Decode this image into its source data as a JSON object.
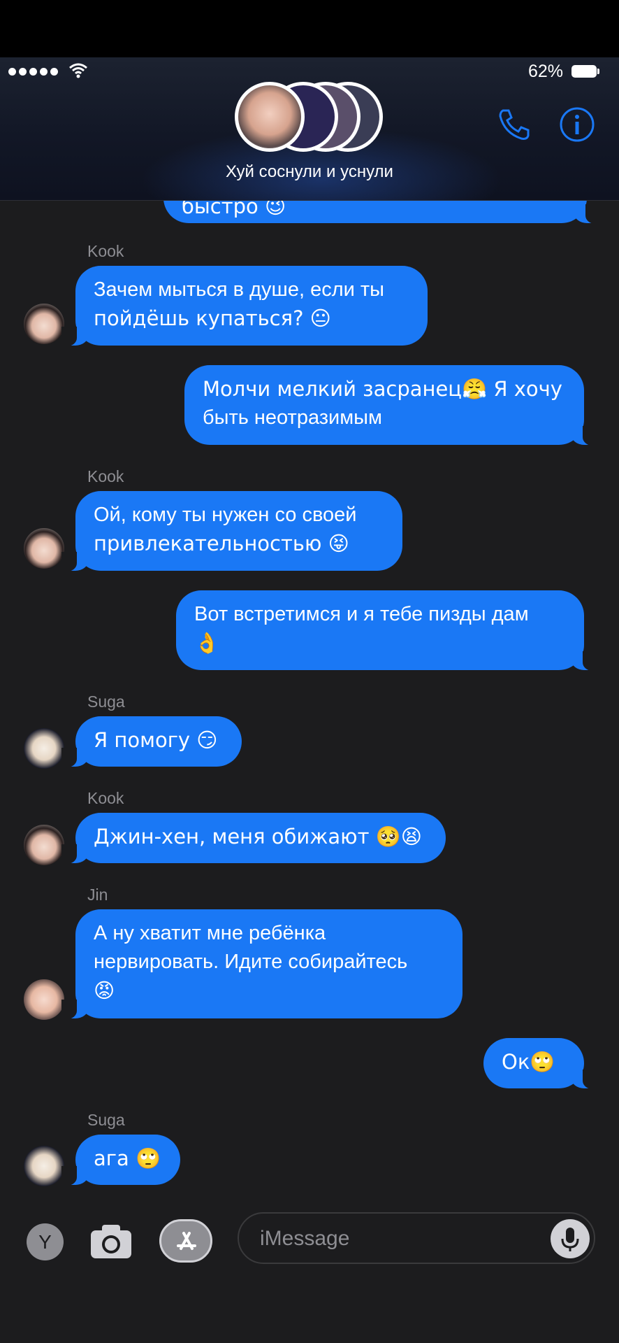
{
  "status": {
    "battery": "62%"
  },
  "header": {
    "group_name": "Хуй соснули и уснули"
  },
  "messages": [
    {
      "type": "out",
      "text": "быстро 😉",
      "partial": true
    },
    {
      "type": "sender",
      "text": "Kook"
    },
    {
      "type": "in",
      "sender": "Kook",
      "lines": [
        "Зачем мыться в душе, если ты",
        "пойдёшь купаться? 😐"
      ]
    },
    {
      "type": "out",
      "lines": [
        "Молчи мелкий засранец😤 Я хочу",
        "быть неотразимым"
      ]
    },
    {
      "type": "sender",
      "text": "Kook"
    },
    {
      "type": "in",
      "sender": "Kook",
      "lines": [
        "Ой, кому ты нужен со своей",
        "привлекательностью 😝"
      ]
    },
    {
      "type": "out",
      "lines": [
        "Вот встретимся и я тебе пизды дам",
        "👌"
      ]
    },
    {
      "type": "sender",
      "text": "Suga"
    },
    {
      "type": "in",
      "sender": "Suga",
      "lines": [
        "Я помогу 😏"
      ]
    },
    {
      "type": "sender",
      "text": "Kook"
    },
    {
      "type": "in",
      "sender": "Kook",
      "lines": [
        "Джин-хен, меня обижают 🥺😫"
      ]
    },
    {
      "type": "sender",
      "text": "Jin"
    },
    {
      "type": "in",
      "sender": "Jin",
      "lines": [
        "А ну хватит мне ребёнка",
        "нервировать. Идите собирайтесь",
        "😡"
      ]
    },
    {
      "type": "out",
      "lines": [
        "Ок🙄"
      ]
    },
    {
      "type": "sender",
      "text": "Suga"
    },
    {
      "type": "in",
      "sender": "Suga",
      "lines": [
        "ага 🙄"
      ]
    }
  ],
  "m": {
    "partial": "быстро 😉",
    "s1": "Kook",
    "b1l1": "Зачем мыться в душе, если ты",
    "b1l2": "пойдёшь купаться? 😐",
    "b2l1": "Молчи мелкий засранец😤 Я хочу",
    "b2l2": "быть неотразимым",
    "s2": "Kook",
    "b3l1": "Ой, кому ты нужен со своей",
    "b3l2": "привлекательностью 😝",
    "b4l1": "Вот встретимся и я тебе пизды дам",
    "b4l2": "👌",
    "s3": "Suga",
    "b5l1": "Я помогу 😏",
    "s4": "Kook",
    "b6l1": "Джин-хен, меня обижают 🥺😫",
    "s5": "Jin",
    "b7l1": "А ну хватит мне ребёнка",
    "b7l2": "нервировать. Идите собирайтесь",
    "b7l3": "😡",
    "b8l1": "Ок🙄",
    "s6": "Suga",
    "b9l1": "ага 🙄"
  },
  "composer": {
    "app_letter": "Y",
    "placeholder": "iMessage"
  }
}
